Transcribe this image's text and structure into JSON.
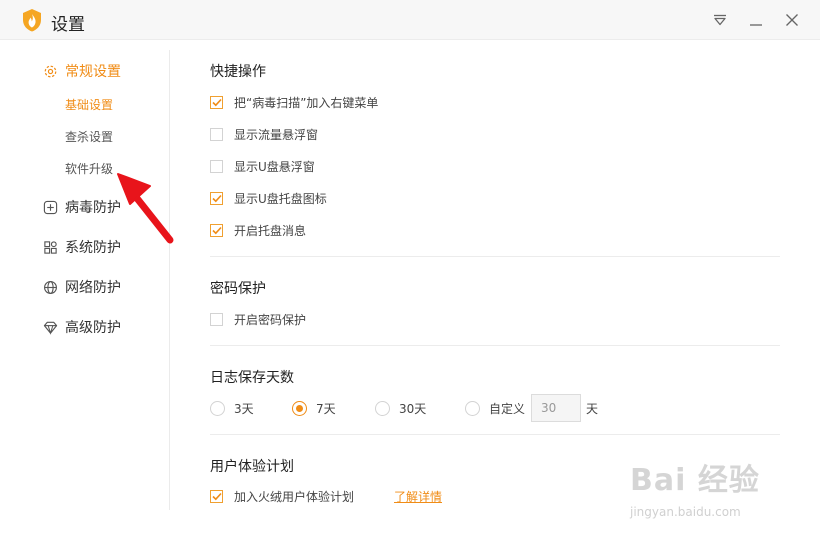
{
  "window": {
    "title": "设置"
  },
  "sidebar": {
    "sections": [
      {
        "label": "常规设置",
        "icon": "gear-icon"
      },
      {
        "label": "病毒防护",
        "icon": "plus-square-icon"
      },
      {
        "label": "系统防护",
        "icon": "grid-icon"
      },
      {
        "label": "网络防护",
        "icon": "globe-icon"
      },
      {
        "label": "高级防护",
        "icon": "diamond-icon"
      }
    ],
    "sub_items": [
      {
        "label": "基础设置"
      },
      {
        "label": "查杀设置"
      },
      {
        "label": "软件升级"
      }
    ]
  },
  "quick_ops": {
    "title": "快捷操作",
    "items": [
      {
        "label": "把“病毒扫描”加入右键菜单",
        "checked": true
      },
      {
        "label": "显示流量悬浮窗",
        "checked": false
      },
      {
        "label": "显示U盘悬浮窗",
        "checked": false
      },
      {
        "label": "显示U盘托盘图标",
        "checked": true
      },
      {
        "label": "开启托盘消息",
        "checked": true
      }
    ]
  },
  "password": {
    "title": "密码保护",
    "items": [
      {
        "label": "开启密码保护",
        "checked": false
      }
    ]
  },
  "log_days": {
    "title": "日志保存天数",
    "options": [
      {
        "label": "3天",
        "selected": false
      },
      {
        "label": "7天",
        "selected": true
      },
      {
        "label": "30天",
        "selected": false
      },
      {
        "label": "自定义",
        "selected": false
      }
    ],
    "custom_value": "30",
    "unit": "天"
  },
  "ux_plan": {
    "title": "用户体验计划",
    "items": [
      {
        "label": "加入火绒用户体验计划",
        "checked": true
      }
    ],
    "link": "了解详情"
  },
  "watermark": {
    "main": "Bai 经验",
    "sub": "jingyan.baidu.com"
  },
  "colors": {
    "accent": "#f08c16",
    "annotation_arrow": "#e8141b"
  }
}
